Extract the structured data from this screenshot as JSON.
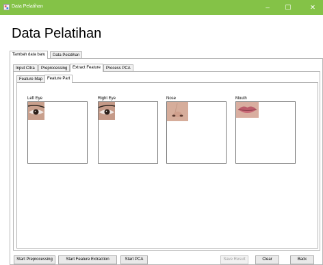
{
  "window": {
    "title": "Data Pelatihan",
    "minimize_glyph": "–",
    "maximize_glyph": "☐",
    "close_glyph": "✕",
    "titlebar_color": "#84c247"
  },
  "page": {
    "heading": "Data Pelatihan"
  },
  "outer_tabs": [
    {
      "label": "Tambah data baru",
      "active": true
    },
    {
      "label": "Data Pelatihan",
      "active": false
    }
  ],
  "inner_tabs": [
    {
      "label": "Input Citra",
      "active": false
    },
    {
      "label": "Preprocessing",
      "active": false
    },
    {
      "label": "Extract Feature",
      "active": true
    },
    {
      "label": "Process PCA",
      "active": false
    }
  ],
  "feature_tabs": [
    {
      "label": "Feature Map",
      "active": false
    },
    {
      "label": "Feature Part",
      "active": true
    }
  ],
  "feature_parts": [
    {
      "label": "Left Eye",
      "icon": "eye-icon"
    },
    {
      "label": "Right Eye",
      "icon": "eye-icon"
    },
    {
      "label": "Nose",
      "icon": "nose-icon"
    },
    {
      "label": "Mouth",
      "icon": "mouth-icon"
    }
  ],
  "buttons": {
    "start_preprocessing": "Start Preprocessing",
    "start_feature_extraction": "Start Feature Extraction",
    "start_pca": "Start PCA",
    "save_result": "Save Result",
    "clear": "Clear",
    "back": "Back"
  }
}
